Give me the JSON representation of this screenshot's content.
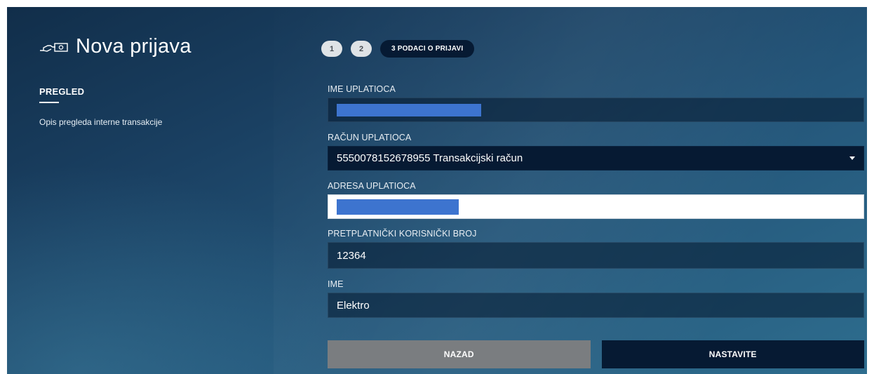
{
  "header": {
    "title": "Nova prijava",
    "icon": "hand-money-icon"
  },
  "steps": {
    "step1": "1",
    "step2": "2",
    "active": "3 PODACI O PRIJAVI"
  },
  "sidebar": {
    "title": "PREGLED",
    "description": "Opis pregleda interne transakcije"
  },
  "form": {
    "payer_name": {
      "label": "IME UPLATIOCA",
      "value": ""
    },
    "payer_account": {
      "label": "RAČUN UPLATIOCA",
      "value": "5550078152678955 Transakcijski račun"
    },
    "payer_address": {
      "label": "ADRESA UPLATIOCA",
      "value": ""
    },
    "subscriber_number": {
      "label": "PRETPLATNIČKI KORISNIČKI BROJ",
      "value": "12364"
    },
    "name": {
      "label": "IME",
      "value": "Elektro"
    }
  },
  "buttons": {
    "back": "NAZAD",
    "next": "NASTAVITE"
  },
  "colors": {
    "accent_dark": "#061a33",
    "redaction": "#3d74cf",
    "back_button": "#7a7d80"
  }
}
